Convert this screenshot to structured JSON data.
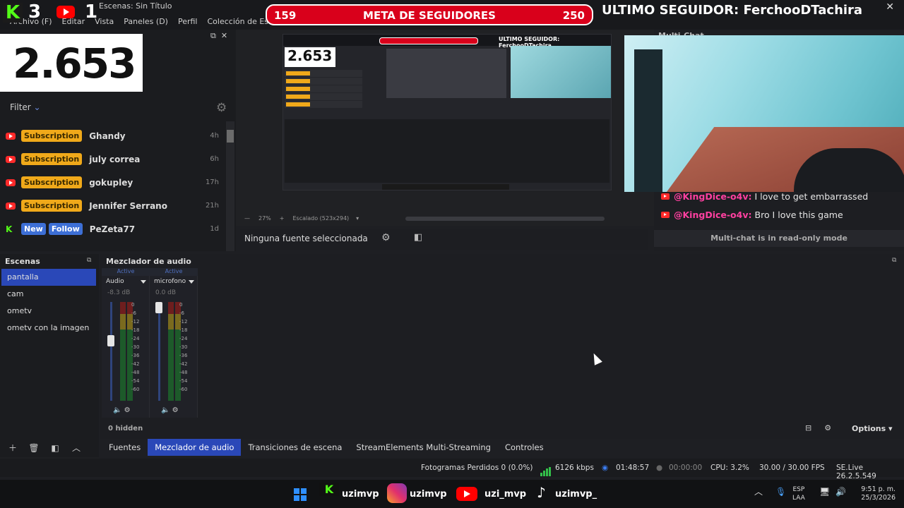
{
  "window": {
    "title": "Escenas: Sin Título",
    "menu": [
      "Archivo (F)",
      "Editar",
      "Vista",
      "Paneles (D)",
      "Perfil",
      "Colección de Escenas"
    ]
  },
  "overlay": {
    "kick_count": "3",
    "youtube_count": "1",
    "viewer_count": "2.653",
    "goal": {
      "current": "159",
      "title": "META DE SEGUIDORES",
      "max": "250"
    },
    "last_follower_label": "ULTIMO SEGUIDOR: FerchooDTachira"
  },
  "activity_feed": {
    "filter_label": "Filter",
    "items": [
      {
        "platform": "youtube",
        "tags": [
          "Subscription"
        ],
        "name": "Ghandy",
        "time": "4h"
      },
      {
        "platform": "youtube",
        "tags": [
          "Subscription"
        ],
        "name": "july correa",
        "time": "6h"
      },
      {
        "platform": "youtube",
        "tags": [
          "Subscription"
        ],
        "name": "gokupley",
        "time": "17h"
      },
      {
        "platform": "youtube",
        "tags": [
          "Subscription"
        ],
        "name": "Jennifer Serrano",
        "time": "21h"
      },
      {
        "platform": "kick",
        "tags": [
          "New",
          "Follow"
        ],
        "name": "PeZeta77",
        "time": "1d"
      }
    ]
  },
  "preview": {
    "zoom": "27%",
    "scale_label": "Escalado (523x294)",
    "nested_viewer": "2.653"
  },
  "multichat": {
    "title": "Multi-Chat",
    "messages": [
      {
        "user": "@KingDice-o4v:",
        "text": "I love to get embarrassed"
      },
      {
        "user": "@KingDice-o4v:",
        "text": "Bro I love this game"
      }
    ],
    "readonly_notice": "Multi-chat is in read-only mode"
  },
  "source_toolbar": {
    "no_source": "Ninguna fuente seleccionada"
  },
  "scenes": {
    "title": "Escenas",
    "items": [
      "pantalla",
      "cam",
      "ometv",
      "ometv con la imagen"
    ],
    "selected": "pantalla"
  },
  "mixer": {
    "title": "Mezclador de audio",
    "channels": [
      {
        "status": "Active",
        "name": "Audio",
        "db": "-8.3 dB",
        "fader_level": 0.62
      },
      {
        "status": "Active",
        "name": "microfono",
        "db": "0.0 dB",
        "fader_level": 1.0
      }
    ],
    "ticks": [
      "0",
      "-6",
      "-12",
      "-18",
      "-24",
      "-30",
      "-36",
      "-42",
      "-48",
      "-54",
      "-60"
    ],
    "hidden_label": "0 hidden",
    "options_label": "Options"
  },
  "dock_tabs": {
    "items": [
      "Fuentes",
      "Mezclador de audio",
      "Transiciones de escena",
      "StreamElements Multi-Streaming",
      "Controles"
    ],
    "active": "Mezclador de audio"
  },
  "status": {
    "dropped_frames": "Fotogramas Perdidos 0 (0.0%)",
    "bitrate": "6126 kbps",
    "live_time": "01:48:57",
    "rec_time": "00:00:00",
    "cpu": "CPU: 3.2%",
    "fps": "30.00 / 30.00 FPS",
    "version": "SE.Live 26.2.5.549"
  },
  "taskbar": {
    "kick_user": "uzimvp",
    "instagram_user": "uzimvp",
    "youtube_user": "uzi_mvp",
    "tiktok_user": "uzimvp_",
    "lang_top": "ESP",
    "lang_bottom": "LAA",
    "time": "9:51 p. m.",
    "date": "25/3/2026"
  },
  "colors": {
    "accent": "#2a48b8",
    "kick": "#53fc18",
    "youtube": "#ff0000",
    "goal": "#d9001b",
    "sub_tag": "#f0a91a",
    "chat_user": "#ff40a0"
  }
}
